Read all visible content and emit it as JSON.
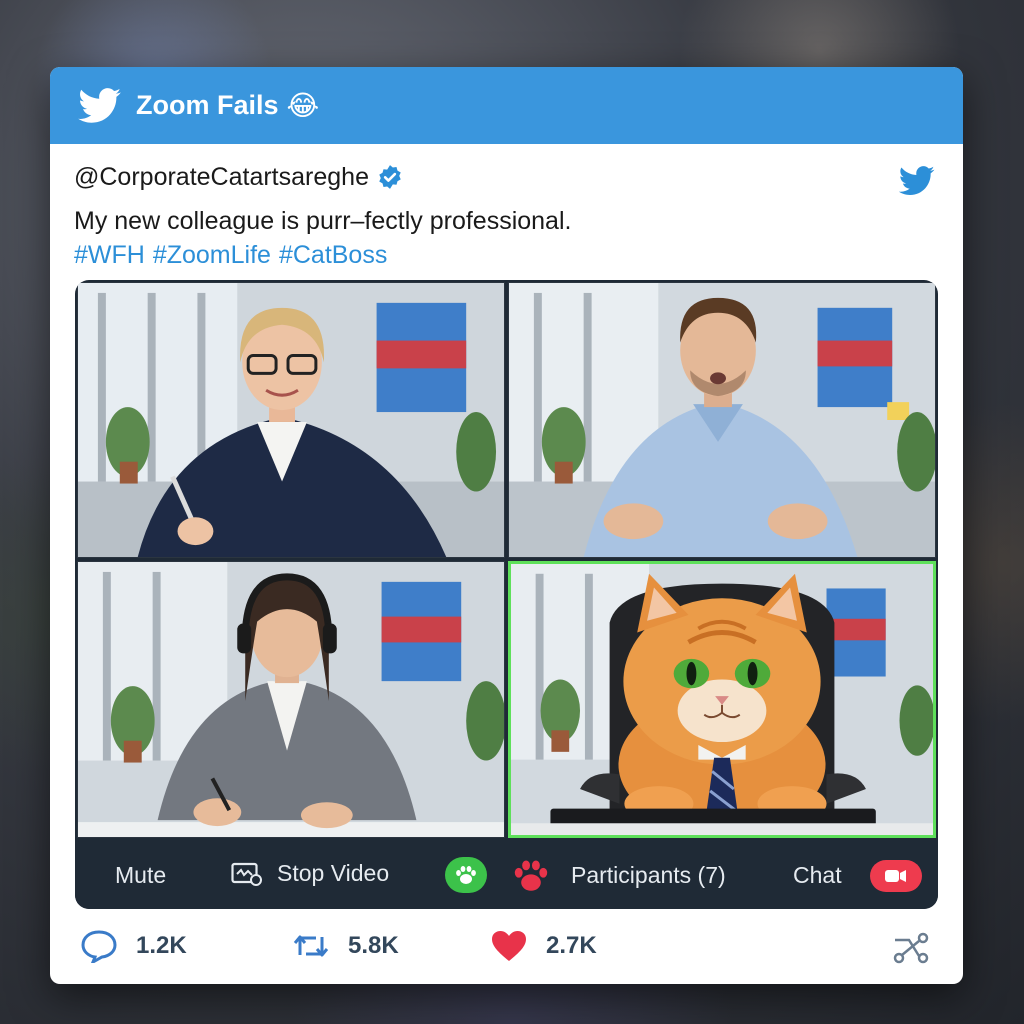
{
  "header": {
    "title": "Zoom Fails",
    "emoji": "😂"
  },
  "tweet": {
    "handle": "@CorporateCatartsareghe",
    "text": "My new colleague is purr–fectly professional.",
    "hashtags": [
      "#WFH",
      "#ZoomLife",
      "#CatBoss"
    ]
  },
  "meeting": {
    "tiles": [
      {
        "name": "participant-woman-blazer",
        "active": false
      },
      {
        "name": "participant-man-shirt",
        "active": false
      },
      {
        "name": "participant-woman-headphones",
        "active": false
      },
      {
        "name": "participant-cat-boss",
        "active": true
      }
    ],
    "controls": {
      "mute_label": "Mute",
      "stop_video_label": "Stop Video",
      "participants_label": "Participants (7)",
      "chat_label": "Chat"
    }
  },
  "stats": {
    "replies": "1.2K",
    "retweets": "5.8K",
    "likes": "2.7K"
  },
  "colors": {
    "header_blue": "#3a96dd",
    "hashtag_blue": "#2c8fd8",
    "active_speaker_green": "#5ee05a",
    "like_red": "#e8334a",
    "control_bar": "#1f2a36"
  },
  "icons": [
    "twitter-bird-icon",
    "verified-badge-icon",
    "laughing-emoji-icon",
    "video-icon",
    "paw-icon",
    "record-icon",
    "reply-icon",
    "retweet-icon",
    "heart-icon",
    "share-icon"
  ]
}
